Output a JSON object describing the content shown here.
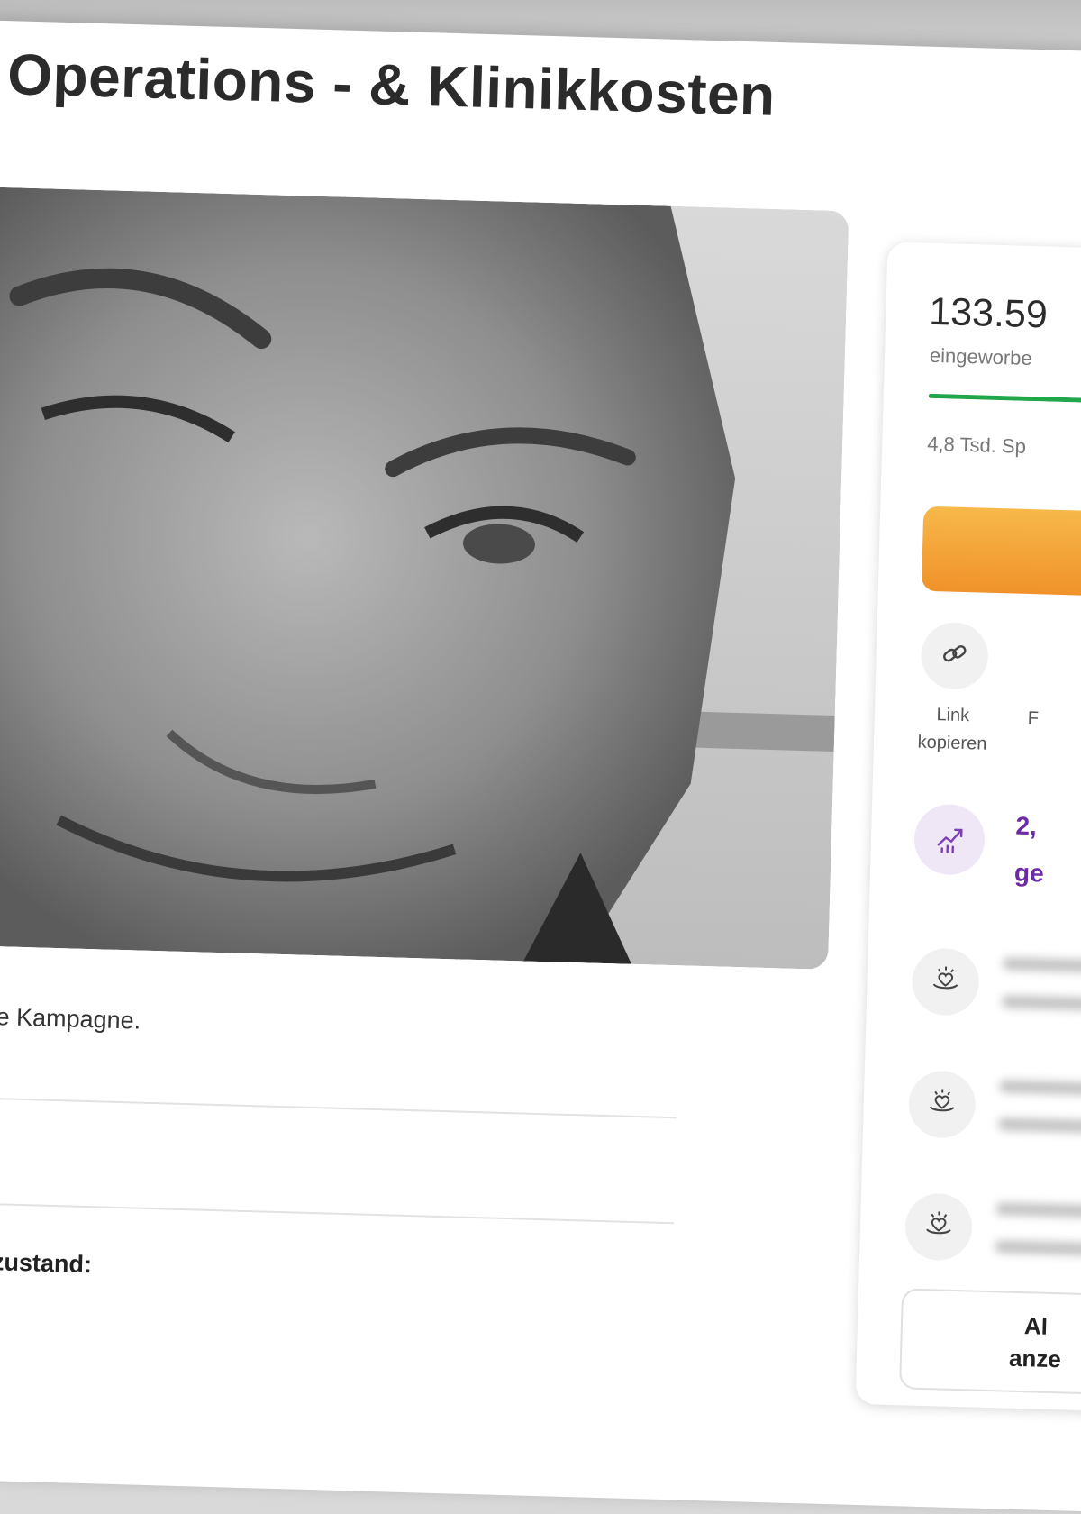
{
  "campaign": {
    "title": "Operations - & Klinikkosten",
    "note_fragment": "ese Kampagne.",
    "section_heading_fragment": "itszustand:"
  },
  "donation_card": {
    "amount_raised": "133.59",
    "raised_label": "eingeworbe",
    "progress_fraction": 0.95,
    "donation_count": "4,8 Tsd. Sp",
    "donate_button_label": "",
    "share": {
      "copy_link_line1": "Link",
      "copy_link_line2": "kopieren",
      "second_option_fragment": "F"
    },
    "trending_line1": "2,",
    "trending_line2": "ge",
    "show_all_line1": "Al",
    "show_all_line2": "anze"
  },
  "icons": {
    "link": "link-icon",
    "trend": "trending-up-icon",
    "donor": "heart-hand-icon"
  },
  "colors": {
    "progress": "#22a64a",
    "donate_button": "#f4a340",
    "trending_text": "#6b2aa6"
  }
}
